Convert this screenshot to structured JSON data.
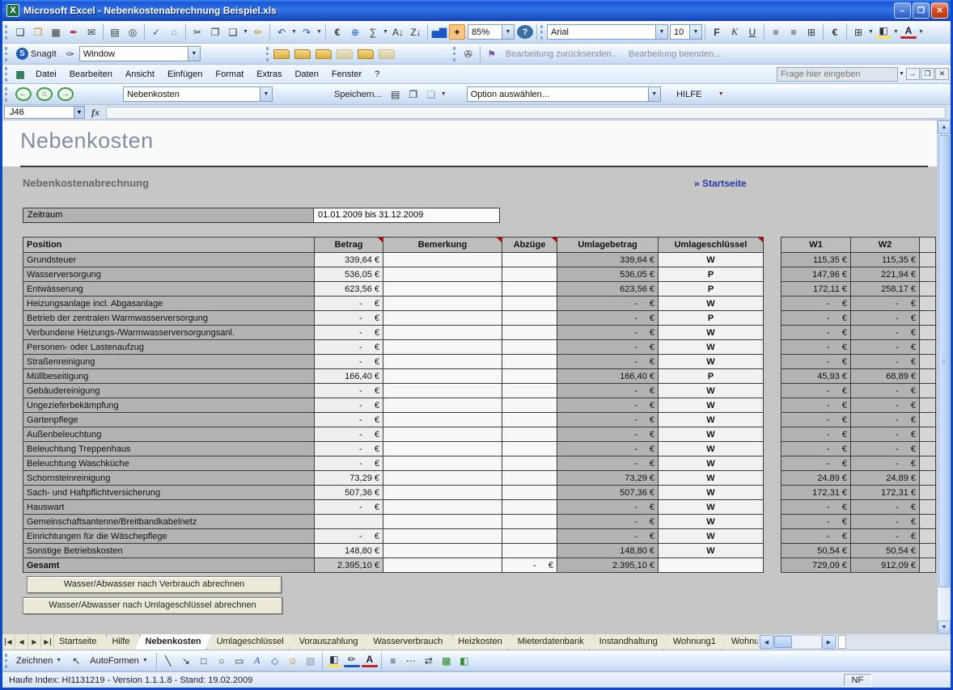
{
  "window": {
    "title": "Microsoft Excel - Nebenkostenabrechnung Beispiel.xls"
  },
  "toolbars": {
    "zoom_value": "85%",
    "font_name": "Arial",
    "font_size": "10",
    "snagit_label": "SnagIt",
    "snagit_mode": "Window",
    "review_send": "Bearbeitung zurücksenden...",
    "review_end": "Bearbeitung beenden...",
    "question_placeholder": "Frage hier eingeben"
  },
  "menu": {
    "items": [
      "Datei",
      "Bearbeiten",
      "Ansicht",
      "Einfügen",
      "Format",
      "Extras",
      "Daten",
      "Fenster",
      "?"
    ]
  },
  "navbar": {
    "sheet_select": "Nebenkosten",
    "save_label": "Speichern...",
    "option_select": "Option auswählen...",
    "help_label": "HILFE"
  },
  "formula_bar": {
    "name_box": "J46",
    "fx": "fx",
    "formula": ""
  },
  "sheet": {
    "page_title": "Nebenkosten",
    "section_title": "Nebenkostenabrechnung",
    "startseite_link": "» Startseite",
    "zeitraum_label": "Zeitraum",
    "zeitraum_value": "01.01.2009 bis 31.12.2009",
    "table": {
      "headers": {
        "pos": {
          "label": "Position",
          "comment": false
        },
        "betrag": {
          "label": "Betrag",
          "comment": true
        },
        "bem": {
          "label": "Bemerkung",
          "comment": true
        },
        "abz": {
          "label": "Abzüge",
          "comment": true
        },
        "umb": {
          "label": "Umlagebetrag",
          "comment": false
        },
        "uml": {
          "label": "Umlageschlüssel",
          "comment": true
        },
        "w1": {
          "label": "W1",
          "comment": false
        },
        "w2": {
          "label": "W2",
          "comment": false
        }
      },
      "rows": [
        {
          "pos": "Grundsteuer",
          "betrag": "339,64 €",
          "bem": "",
          "abz": "",
          "umb": "339,64 €",
          "uml": "W",
          "w1": "115,35 €",
          "w2": "115,35 €"
        },
        {
          "pos": "Wasserversorgung",
          "betrag": "536,05 €",
          "bem": "",
          "abz": "",
          "umb": "536,05 €",
          "uml": "P",
          "w1": "147,96 €",
          "w2": "221,94 €"
        },
        {
          "pos": "Entwässerung",
          "betrag": "623,56 €",
          "bem": "",
          "abz": "",
          "umb": "623,56 €",
          "uml": "P",
          "w1": "172,11 €",
          "w2": "258,17 €"
        },
        {
          "pos": "Heizungsanlage incl. Abgasanlage",
          "betrag": "-     €",
          "bem": "",
          "abz": "",
          "umb": "-     €",
          "uml": "W",
          "w1": "-     €",
          "w2": "-     €"
        },
        {
          "pos": "Betrieb der zentralen Warmwasserversorgung",
          "betrag": "-     €",
          "bem": "",
          "abz": "",
          "umb": "-     €",
          "uml": "P",
          "w1": "-     €",
          "w2": "-     €"
        },
        {
          "pos": "Verbundene Heizungs-/Warmwasserversorgungsanl.",
          "betrag": "-     €",
          "bem": "",
          "abz": "",
          "umb": "-     €",
          "uml": "W",
          "w1": "-     €",
          "w2": "-     €"
        },
        {
          "pos": "Personen- oder Lastenaufzug",
          "betrag": "-     €",
          "bem": "",
          "abz": "",
          "umb": "-     €",
          "uml": "W",
          "w1": "-     €",
          "w2": "-     €"
        },
        {
          "pos": "Straßenreinigung",
          "betrag": "-     €",
          "bem": "",
          "abz": "",
          "umb": "-     €",
          "uml": "W",
          "w1": "-     €",
          "w2": "-     €"
        },
        {
          "pos": "Müllbeseitigung",
          "betrag": "166,40 €",
          "bem": "",
          "abz": "",
          "umb": "166,40 €",
          "uml": "P",
          "w1": "45,93 €",
          "w2": "68,89 €"
        },
        {
          "pos": "Gebäudereinigung",
          "betrag": "-     €",
          "bem": "",
          "abz": "",
          "umb": "-     €",
          "uml": "W",
          "w1": "-     €",
          "w2": "-     €"
        },
        {
          "pos": "Ungezieferbekämpfung",
          "betrag": "-     €",
          "bem": "",
          "abz": "",
          "umb": "-     €",
          "uml": "W",
          "w1": "-     €",
          "w2": "-     €"
        },
        {
          "pos": "Gartenpflege",
          "betrag": "-     €",
          "bem": "",
          "abz": "",
          "umb": "-     €",
          "uml": "W",
          "w1": "-     €",
          "w2": "-     €"
        },
        {
          "pos": "Außenbeleuchtung",
          "betrag": "-     €",
          "bem": "",
          "abz": "",
          "umb": "-     €",
          "uml": "W",
          "w1": "-     €",
          "w2": "-     €"
        },
        {
          "pos": "Beleuchtung Treppenhaus",
          "betrag": "-     €",
          "bem": "",
          "abz": "",
          "umb": "-     €",
          "uml": "W",
          "w1": "-     €",
          "w2": "-     €"
        },
        {
          "pos": "Beleuchtung Waschküche",
          "betrag": "-     €",
          "bem": "",
          "abz": "",
          "umb": "-     €",
          "uml": "W",
          "w1": "-     €",
          "w2": "-     €"
        },
        {
          "pos": "Schornsteinreinigung",
          "betrag": "73,29 €",
          "bem": "",
          "abz": "",
          "umb": "73,29 €",
          "uml": "W",
          "w1": "24,89 €",
          "w2": "24,89 €"
        },
        {
          "pos": "Sach- und Haftpflichtversicherung",
          "betrag": "507,36 €",
          "bem": "",
          "abz": "",
          "umb": "507,36 €",
          "uml": "W",
          "w1": "172,31 €",
          "w2": "172,31 €"
        },
        {
          "pos": "Hauswart",
          "betrag": "-     €",
          "bem": "",
          "abz": "",
          "umb": "-     €",
          "uml": "W",
          "w1": "-     €",
          "w2": "-     €"
        },
        {
          "pos": "Gemeinschaftsantenne/Breitbandkabelnetz",
          "betrag": "",
          "bem": "",
          "abz": "",
          "umb": "-     €",
          "uml": "W",
          "w1": "-     €",
          "w2": "-     €"
        },
        {
          "pos": "Einrichtungen für die Wäschepflege",
          "betrag": "-     €",
          "bem": "",
          "abz": "",
          "umb": "-     €",
          "uml": "W",
          "w1": "-     €",
          "w2": "-     €"
        },
        {
          "pos": "Sonstige Betriebskosten",
          "betrag": "148,80 €",
          "bem": "",
          "abz": "",
          "umb": "148,80 €",
          "uml": "W",
          "w1": "50,54 €",
          "w2": "50,54 €"
        }
      ],
      "total": {
        "pos": "Gesamt",
        "betrag": "2.395,10 €",
        "bem": "",
        "abz": "-     €",
        "umb": "2.395,10 €",
        "uml": "",
        "w1": "729,09 €",
        "w2": "912,09 €"
      }
    },
    "buttons": {
      "verbrauch": "Wasser/Abwasser nach Verbrauch abrechnen",
      "umlageschluessel": "Wasser/Abwasser nach Umlageschlüssel abrechnen"
    }
  },
  "tabs": {
    "items": [
      "Startseite",
      "Hilfe",
      "Nebenkosten",
      "Umlageschlüssel",
      "Vorauszahlung",
      "Wasserverbrauch",
      "Heizkosten",
      "Mieterdatenbank",
      "Instandhaltung",
      "Wohnung1",
      "Wohnu"
    ],
    "active": "Nebenkosten"
  },
  "drawing": {
    "zeichnen_label": "Zeichnen",
    "autoformen_label": "AutoFormen"
  },
  "status": {
    "left": "Haufe Index: HI1131219 - Version 1.1.1.8 - Stand: 19.02.2009",
    "right": "NF"
  },
  "icons": {
    "standard": [
      {
        "name": "new",
        "glyph": "❏"
      },
      {
        "name": "open",
        "glyph": "❒",
        "style": "gold"
      },
      {
        "name": "save",
        "glyph": "▦"
      },
      {
        "name": "permission",
        "glyph": "✒",
        "style": "red"
      },
      {
        "name": "email",
        "glyph": "✉"
      },
      {
        "sep": true
      },
      {
        "name": "print",
        "glyph": "▤"
      },
      {
        "name": "print-preview",
        "glyph": "◎"
      },
      {
        "sep": true
      },
      {
        "name": "spelling",
        "glyph": "✓",
        "style": "blue"
      },
      {
        "name": "research",
        "glyph": "◌"
      },
      {
        "sep": true
      },
      {
        "name": "cut",
        "glyph": "✂"
      },
      {
        "name": "copy",
        "glyph": "❐"
      },
      {
        "name": "paste",
        "glyph": "❑",
        "dd": true
      },
      {
        "name": "format-painter",
        "glyph": "✏",
        "style": "gold"
      },
      {
        "sep": true
      },
      {
        "name": "undo",
        "glyph": "↶",
        "style": "blue",
        "dd": true
      },
      {
        "name": "redo",
        "glyph": "↷",
        "style": "blue",
        "dd": true
      },
      {
        "sep": true
      },
      {
        "name": "euro-convert",
        "glyph": "€",
        "style": "b"
      },
      {
        "name": "hyperlink",
        "glyph": "⊕",
        "style": "blue"
      },
      {
        "name": "autosum",
        "glyph": "∑",
        "dd": true
      },
      {
        "name": "sort-asc",
        "glyph": "A↓"
      },
      {
        "name": "sort-desc",
        "glyph": "Z↓"
      },
      {
        "sep": true
      },
      {
        "name": "chart-wizard",
        "glyph": "▅▇",
        "style": "blue"
      },
      {
        "name": "addin",
        "glyph": "✦",
        "style": "hl"
      }
    ],
    "formatting": [
      {
        "name": "bold",
        "glyph": "F",
        "style": "b"
      },
      {
        "name": "italic",
        "glyph": "K",
        "style": "i"
      },
      {
        "name": "underline",
        "glyph": "U",
        "style": "u"
      },
      {
        "sep": true
      },
      {
        "name": "align-left",
        "glyph": "≡"
      },
      {
        "name": "align-center",
        "glyph": "≡"
      },
      {
        "name": "merge-center",
        "glyph": "⊞"
      },
      {
        "sep": true
      },
      {
        "name": "euro-style",
        "glyph": "€",
        "style": "b"
      },
      {
        "sep": true
      },
      {
        "name": "borders",
        "glyph": "⊞",
        "dd": true
      },
      {
        "name": "fill-color",
        "glyph": "◧",
        "style": "uy",
        "dd": true
      },
      {
        "name": "font-color",
        "glyph": "A",
        "style": "ur",
        "dd": true
      }
    ],
    "snagit_extra": [
      {
        "name": "folder-1",
        "glyph": "",
        "style": "folder"
      },
      {
        "name": "folder-2",
        "glyph": "",
        "style": "folder"
      },
      {
        "name": "folder-3",
        "glyph": "",
        "style": "folder"
      },
      {
        "name": "folder-4",
        "glyph": "",
        "style": "folder faded"
      },
      {
        "name": "folder-5",
        "glyph": "",
        "style": "folder"
      },
      {
        "name": "folder-6",
        "glyph": "",
        "style": "folder faded"
      }
    ],
    "review": [
      {
        "name": "attachment",
        "glyph": "✇"
      },
      {
        "sep": true
      },
      {
        "name": "review-flag",
        "glyph": "⚑",
        "style": "purple"
      }
    ],
    "nav": [
      {
        "name": "nav-back",
        "glyph": "←",
        "style": "navc"
      },
      {
        "name": "nav-home",
        "glyph": "⌂",
        "style": "navc"
      },
      {
        "name": "nav-forward",
        "glyph": "→",
        "style": "navc"
      }
    ],
    "nav_save": [
      {
        "name": "nav-print",
        "glyph": "▤"
      },
      {
        "name": "nav-copy",
        "glyph": "❐"
      },
      {
        "name": "nav-paste",
        "glyph": "❑",
        "style": "faded",
        "dd": true
      }
    ],
    "drawing": [
      {
        "name": "select-arrow",
        "glyph": "↖"
      },
      {
        "sep": true
      },
      {
        "name": "line",
        "glyph": "╲"
      },
      {
        "name": "arrow",
        "glyph": "↘"
      },
      {
        "name": "rectangle",
        "glyph": "□"
      },
      {
        "name": "oval",
        "glyph": "○"
      },
      {
        "name": "textbox",
        "glyph": "▭"
      },
      {
        "name": "wordart",
        "glyph": "A",
        "style": "i blue"
      },
      {
        "name": "diagram",
        "glyph": "◇",
        "style": "blue"
      },
      {
        "name": "clipart",
        "glyph": "☺",
        "style": "gold"
      },
      {
        "name": "picture",
        "glyph": "▨",
        "style": "faded"
      },
      {
        "sep": true
      },
      {
        "name": "fill-color",
        "glyph": "◧",
        "style": "uy"
      },
      {
        "name": "line-color",
        "glyph": "✏",
        "style": "ub"
      },
      {
        "name": "font-color",
        "glyph": "A",
        "style": "ur"
      },
      {
        "sep": true
      },
      {
        "name": "line-style",
        "glyph": "≡"
      },
      {
        "name": "dash-style",
        "glyph": "⋯"
      },
      {
        "name": "arrow-style",
        "glyph": "⇄"
      },
      {
        "name": "shadow",
        "glyph": "▩",
        "style": "green"
      },
      {
        "name": "threed",
        "glyph": "◧",
        "style": "green"
      }
    ],
    "tabnav": [
      {
        "name": "first-sheet",
        "glyph": "◀",
        "style": "barl"
      },
      {
        "name": "prev-sheet",
        "glyph": "◀"
      },
      {
        "name": "next-sheet",
        "glyph": "▶"
      },
      {
        "name": "last-sheet",
        "glyph": "▶",
        "style": "barr"
      }
    ]
  }
}
